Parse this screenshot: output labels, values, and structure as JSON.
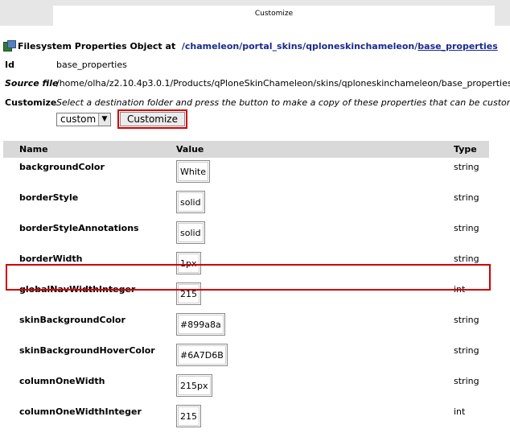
{
  "tab": {
    "title": "Customize"
  },
  "header": {
    "title": "Filesystem Properties Object at",
    "path": [
      "/chameleon",
      "/portal_skins",
      "/qploneskinchameleon",
      "/",
      "base_properties"
    ]
  },
  "info": {
    "id_label": "Id",
    "id_value": "base_properties",
    "source_label": "Source file",
    "source_value": "/home/olha/z2.10.4p3.0.1/Products/qPloneSkinChameleon/skins/qploneskinchameleon/base_properties",
    "customize_label": "Customize",
    "customize_desc": "Select a destination folder and press the button to make a copy of these properties that can be customize",
    "folder_value": "custom",
    "customize_button": "Customize"
  },
  "table": {
    "headers": [
      "Name",
      "Value",
      "Type"
    ],
    "rows": [
      {
        "name": "backgroundColor",
        "value": "White",
        "type": "string"
      },
      {
        "name": "borderStyle",
        "value": "solid",
        "type": "string"
      },
      {
        "name": "borderStyleAnnotations",
        "value": "solid",
        "type": "string"
      },
      {
        "name": "borderWidth",
        "value": "1px",
        "type": "string"
      },
      {
        "name": "globalNavWidthInteger",
        "value": "215",
        "type": "int"
      },
      {
        "name": "skinBackgroundColor",
        "value": "#899a8a",
        "type": "string"
      },
      {
        "name": "skinBackgroundHoverColor",
        "value": "#6A7D6B",
        "type": "string"
      },
      {
        "name": "columnOneWidth",
        "value": "215px",
        "type": "string"
      },
      {
        "name": "columnOneWidthInteger",
        "value": "215",
        "type": "int"
      }
    ]
  },
  "colors": {
    "highlight": "#d00000",
    "link": "#1a2a8c",
    "header_bg": "#d9d9d9"
  }
}
